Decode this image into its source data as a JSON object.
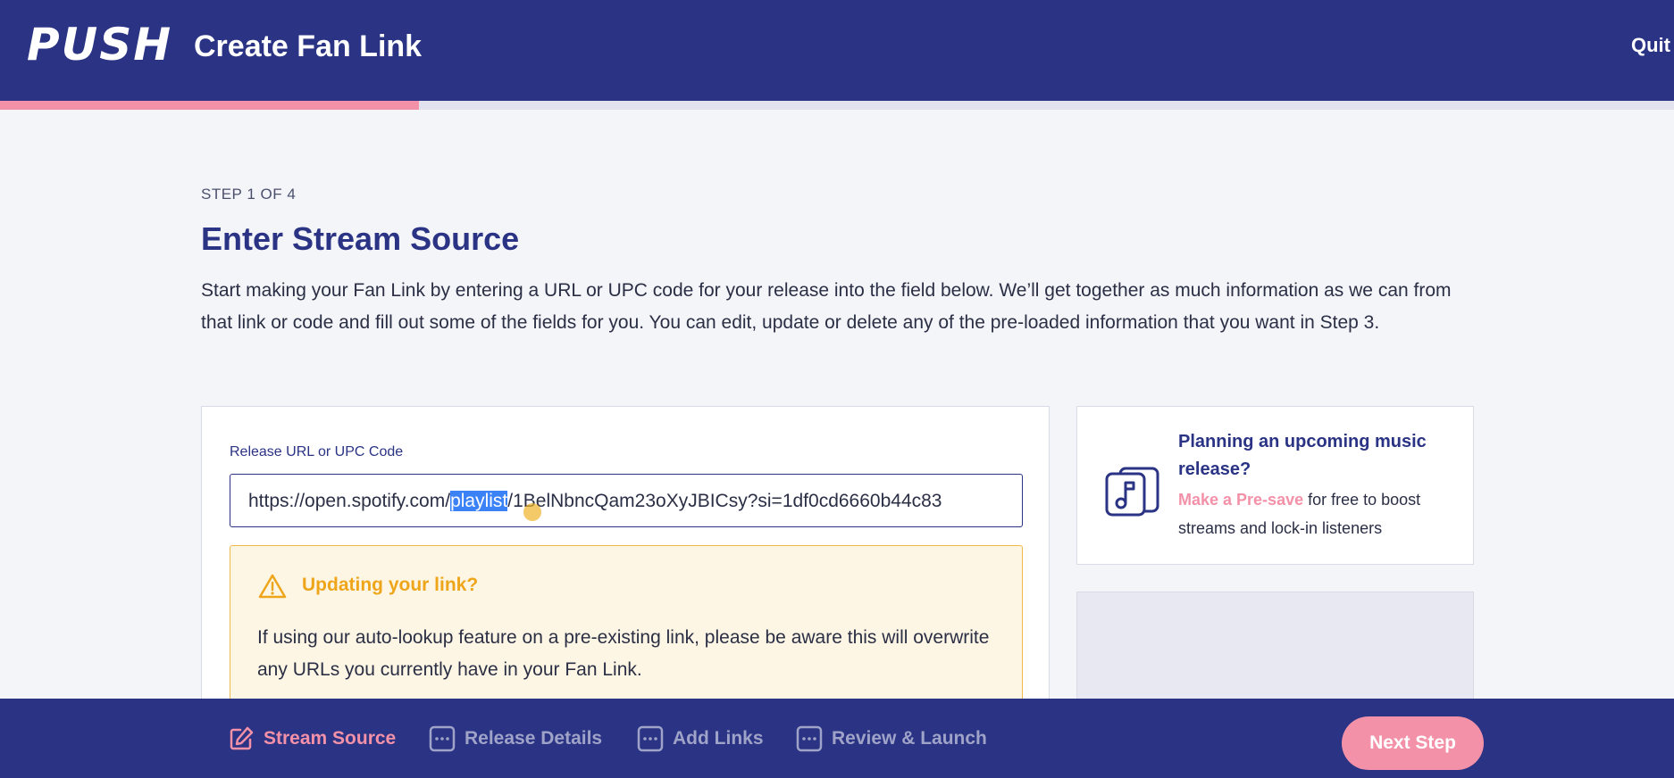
{
  "header": {
    "logo": "PUSH",
    "title": "Create Fan Link",
    "quit_label": "Quit",
    "progress_percent": 25
  },
  "main": {
    "step_label": "STEP 1 OF 4",
    "title": "Enter Stream Source",
    "intro": "Start making your Fan Link by entering a URL or UPC code for your release into the field below. We’ll get together as much information as we can from that link or code and fill out some of the fields for you. You can edit, update or delete any of the pre-loaded information that you want in Step 3.",
    "field_label": "Release URL or UPC Code",
    "url_value": {
      "before": "https://open.spotify.com/",
      "selected": "playlist",
      "after": "/1BelNbncQam23oXyJBICsy?si=1df0cd6660b44c83"
    },
    "warning": {
      "icon": "warning-triangle-icon",
      "title": "Updating your link?",
      "text": "If using our auto-lookup feature on a pre-existing link, please be aware this will overwrite any URLs you currently have in your Fan Link."
    }
  },
  "side": {
    "icon": "music-note-icon",
    "title": "Planning an upcoming music release?",
    "link_text": "Make a Pre-save",
    "text": " for free to boost streams and lock-in listeners"
  },
  "footer": {
    "nav": [
      {
        "label": "Stream Source",
        "icon": "edit-icon",
        "active": true
      },
      {
        "label": "Release Details",
        "icon": "more-icon",
        "active": false
      },
      {
        "label": "Add Links",
        "icon": "more-icon",
        "active": false
      },
      {
        "label": "Review & Launch",
        "icon": "more-icon",
        "active": false
      }
    ],
    "next_label": "Next Step"
  },
  "colors": {
    "primary": "#2a3384",
    "accent": "#f391a8",
    "warning": "#eea51a",
    "background": "#f4f5f9"
  }
}
